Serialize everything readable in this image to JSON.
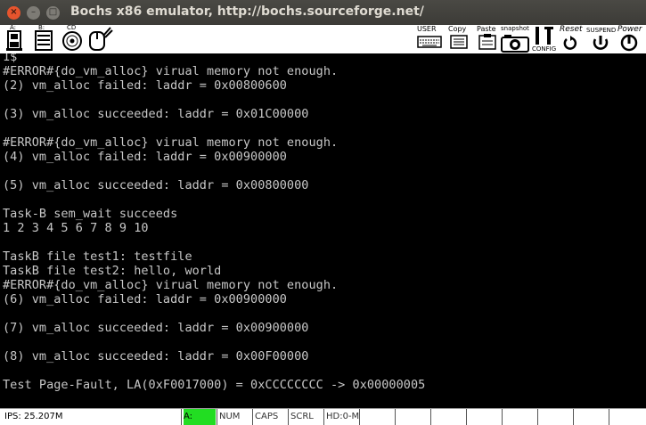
{
  "window": {
    "title": "Bochs x86 emulator, http://bochs.sourceforge.net/",
    "close_glyph": "×",
    "min_glyph": "–",
    "max_glyph": "□"
  },
  "toolbar": {
    "drive_a": "A:",
    "drive_b": "B:",
    "cdrom": "CD",
    "user": "USER",
    "copy": "Copy",
    "paste": "Paste",
    "snapshot": "snapshot",
    "config": "CONFIG",
    "reset": "Reset",
    "suspend": "SUSPEND",
    "power": "Power"
  },
  "console": {
    "lines": [
      "1$",
      "#ERROR#{do_vm_alloc} virual memory not enough.",
      "(2) vm_alloc failed: laddr = 0x00800600",
      "",
      "(3) vm_alloc succeeded: laddr = 0x01C00000",
      "",
      "#ERROR#{do_vm_alloc} virual memory not enough.",
      "(4) vm_alloc failed: laddr = 0x00900000",
      "",
      "(5) vm_alloc succeeded: laddr = 0x00800000",
      "",
      "Task-B sem_wait succeeds",
      "1 2 3 4 5 6 7 8 9 10",
      "",
      "TaskB file test1: testfile",
      "TaskB file test2: hello, world",
      "#ERROR#{do_vm_alloc} virual memory not enough.",
      "(6) vm_alloc failed: laddr = 0x00900000",
      "",
      "(7) vm_alloc succeeded: laddr = 0x00900000",
      "",
      "(8) vm_alloc succeeded: laddr = 0x00F00000",
      "",
      "Test Page-Fault, LA(0xF0017000) = 0xCCCCCCCC -> 0x00000005"
    ]
  },
  "status": {
    "ips": "IPS: 25.207M",
    "a": "A:",
    "num": "NUM",
    "caps": "CAPS",
    "scrl": "SCRL",
    "hd": "HD:0-M"
  }
}
